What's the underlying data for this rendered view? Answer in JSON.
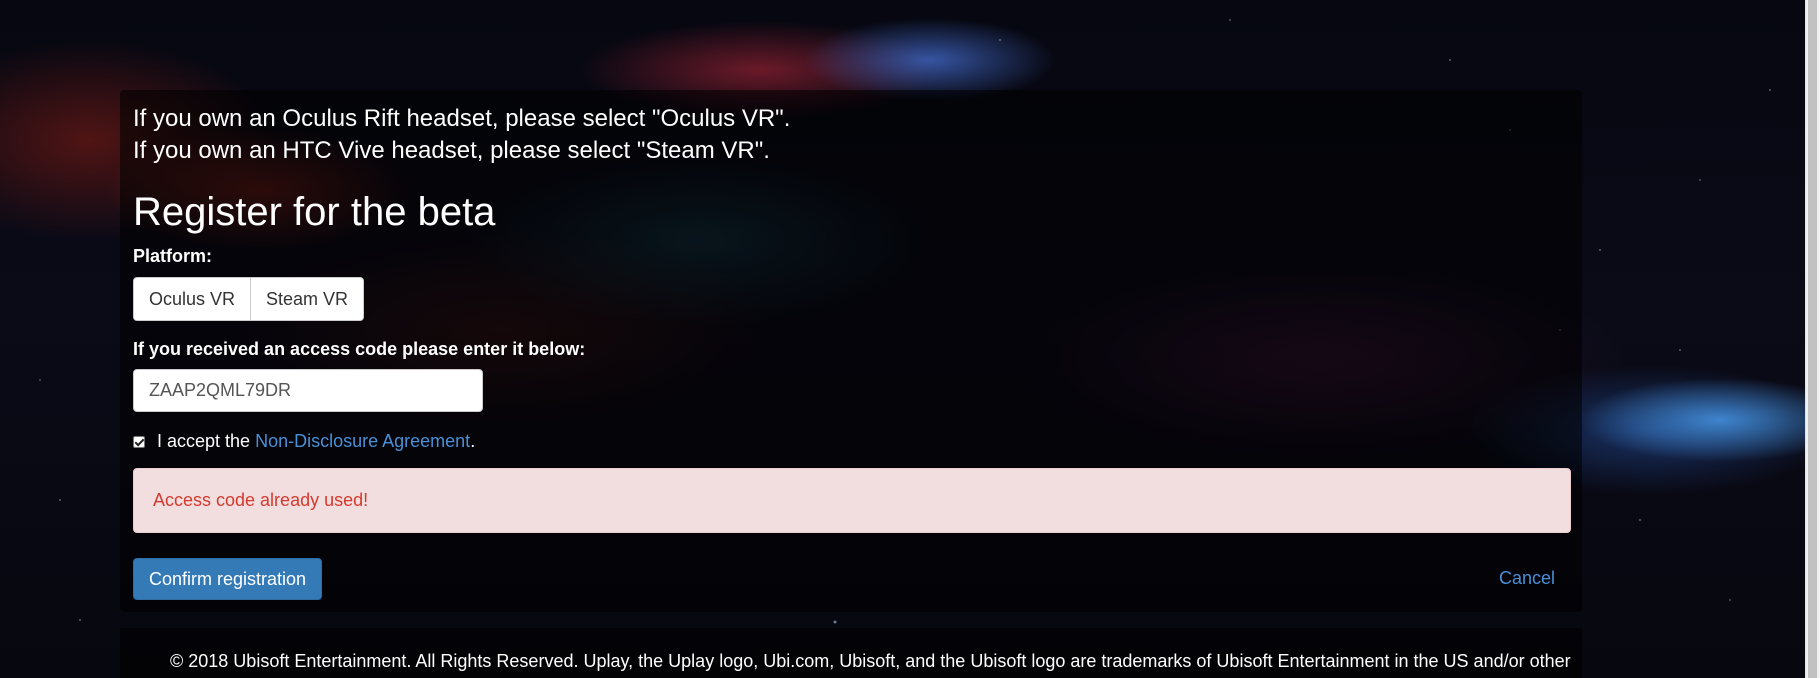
{
  "intro": {
    "line1": "If you own an Oculus Rift headset, please select \"Oculus VR\".",
    "line2": "If you own an HTC Vive headset, please select \"Steam VR\"."
  },
  "heading": "Register for the beta",
  "platform": {
    "label": "Platform:",
    "options": [
      "Oculus VR",
      "Steam VR"
    ]
  },
  "access_code": {
    "label": "If you received an access code please enter it below:",
    "value": "ZAAP2QML79DR"
  },
  "nda": {
    "checked": true,
    "prefix": "I accept the",
    "link_text": "Non-Disclosure Agreement",
    "suffix": "."
  },
  "alert": {
    "message": "Access code already used!"
  },
  "actions": {
    "confirm_label": "Confirm registration",
    "cancel_label": "Cancel"
  },
  "footer": {
    "text": "© 2018 Ubisoft Entertainment. All Rights Reserved. Uplay, the Uplay logo, Ubi.com, Ubisoft, and the Ubisoft logo are trademarks of Ubisoft Entertainment in the US and/or other"
  },
  "colors": {
    "primary": "#337ab7",
    "link": "#4a90d9",
    "alert_bg": "#f2dede",
    "alert_text": "#d43a2f"
  }
}
